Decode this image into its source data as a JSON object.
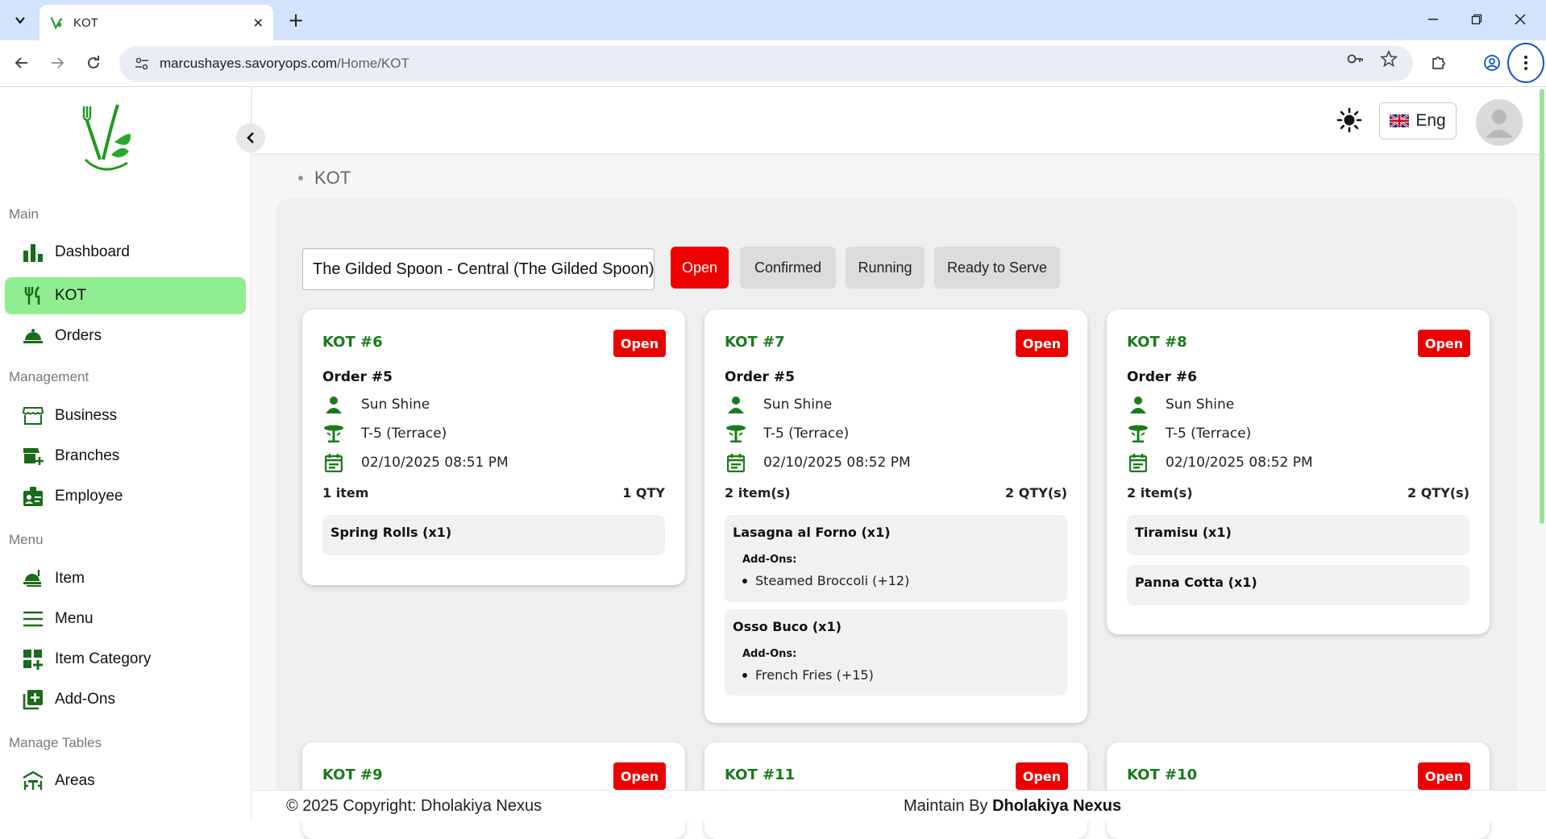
{
  "browser": {
    "tab_title": "KOT",
    "url_host": "marcushayes.savoryops.com",
    "url_path": "/Home/KOT"
  },
  "sidebar": {
    "sections": {
      "main": "Main",
      "management": "Management",
      "menu": "Menu",
      "tables": "Manage Tables"
    },
    "items": {
      "dashboard": "Dashboard",
      "kot": "KOT",
      "orders": "Orders",
      "business": "Business",
      "branches": "Branches",
      "employee": "Employee",
      "item": "Item",
      "menu": "Menu",
      "item_category": "Item Category",
      "addons": "Add-Ons",
      "areas": "Areas"
    }
  },
  "header": {
    "language": "Eng"
  },
  "breadcrumb": "KOT",
  "filters": {
    "branch": "The Gilded Spoon - Central (The Gilded Spoon)",
    "open": "Open",
    "confirmed": "Confirmed",
    "running": "Running",
    "ready": "Ready to Serve"
  },
  "cards": [
    {
      "kot": "KOT #6",
      "status": "Open",
      "order": "Order #5",
      "customer": "Sun Shine",
      "table": "T-5 (Terrace)",
      "datetime": "02/10/2025 08:51 PM",
      "item_count": "1 item",
      "qty": "1 QTY",
      "items": [
        {
          "name": "Spring Rolls (x1)"
        }
      ]
    },
    {
      "kot": "KOT #7",
      "status": "Open",
      "order": "Order #5",
      "customer": "Sun Shine",
      "table": "T-5 (Terrace)",
      "datetime": "02/10/2025 08:52 PM",
      "item_count": "2 item(s)",
      "qty": "2 QTY(s)",
      "items": [
        {
          "name": "Lasagna al Forno (x1)",
          "addons_label": "Add-Ons:",
          "addon": "Steamed Broccoli (+12)"
        },
        {
          "name": "Osso Buco (x1)",
          "addons_label": "Add-Ons:",
          "addon": "French Fries (+15)"
        }
      ]
    },
    {
      "kot": "KOT #8",
      "status": "Open",
      "order": "Order #6",
      "customer": "Sun Shine",
      "table": "T-5 (Terrace)",
      "datetime": "02/10/2025 08:52 PM",
      "item_count": "2 item(s)",
      "qty": "2 QTY(s)",
      "items": [
        {
          "name": "Tiramisu (x1)"
        },
        {
          "name": "Panna Cotta (x1)"
        }
      ]
    },
    {
      "kot": "KOT #9",
      "status": "Open"
    },
    {
      "kot": "KOT #11",
      "status": "Open"
    },
    {
      "kot": "KOT #10",
      "status": "Open"
    }
  ],
  "footer": {
    "copyright": "© 2025 Copyright: Dholakiya Nexus",
    "maintain_prefix": "Maintain By",
    "maintain_name": "Dholakiya Nexus"
  },
  "colors": {
    "accent_green": "#1a7a1a",
    "active_nav": "#90ee90",
    "status_red": "#ee0000"
  }
}
